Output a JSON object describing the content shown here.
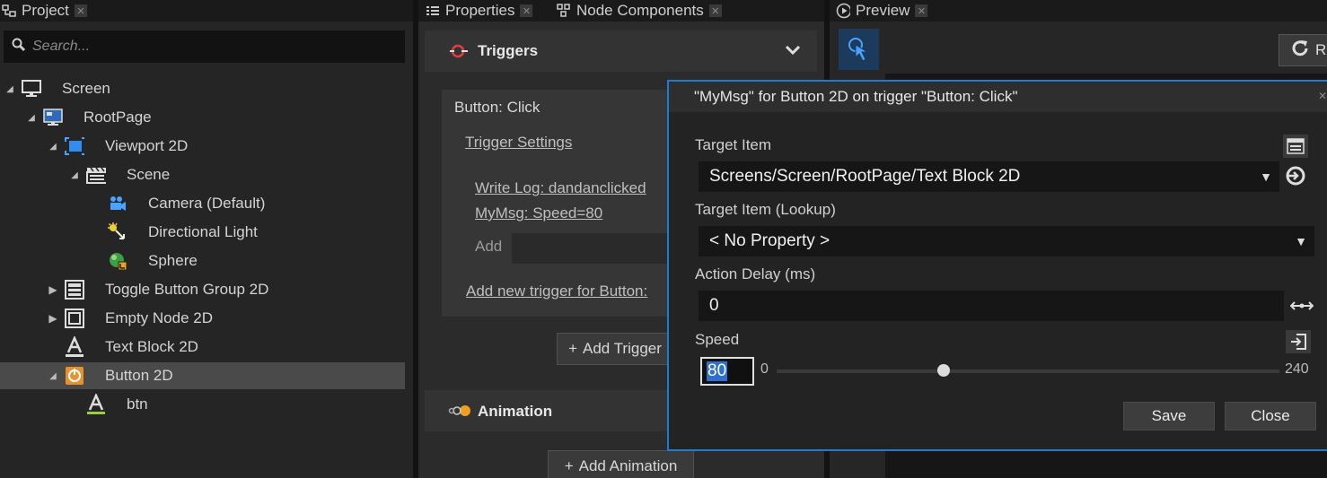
{
  "tabs": {
    "project": "Project",
    "properties": "Properties",
    "node_components": "Node Components",
    "preview": "Preview"
  },
  "project": {
    "search_placeholder": "Search...",
    "tree": [
      {
        "label": "Screen",
        "icon": "monitor-icon",
        "expanded": true
      },
      {
        "label": "RootPage",
        "icon": "page-icon",
        "expanded": true
      },
      {
        "label": "Viewport 2D",
        "icon": "viewport-icon",
        "expanded": true
      },
      {
        "label": "Scene",
        "icon": "clapper-icon",
        "expanded": true
      },
      {
        "label": "Camera (Default)",
        "icon": "camera-icon"
      },
      {
        "label": "Directional Light",
        "icon": "light-icon"
      },
      {
        "label": "Sphere",
        "icon": "sphere-icon"
      },
      {
        "label": "Toggle Button Group 2D",
        "icon": "toggle-group-icon",
        "expanded": false
      },
      {
        "label": "Empty Node 2D",
        "icon": "empty-node-icon",
        "expanded": false
      },
      {
        "label": "Text Block 2D",
        "icon": "text-icon"
      },
      {
        "label": "Button 2D",
        "icon": "button-icon",
        "expanded": true,
        "selected": true
      },
      {
        "label": "btn",
        "icon": "text-icon"
      }
    ]
  },
  "properties": {
    "triggers_title": "Triggers",
    "trigger_name": "Button: Click",
    "trigger_settings": "Trigger Settings",
    "actions": [
      "Write Log: dandanclicked",
      "MyMsg: Speed=80"
    ],
    "add_label": "Add",
    "add_new_trigger": "Add new trigger for Button:",
    "add_trigger_button": "Add Trigger",
    "animation_title": "Animation",
    "add_animation_button": "Add Animation"
  },
  "preview": {
    "refresh_label": "R"
  },
  "dialog": {
    "title": "\"MyMsg\" for Button 2D on trigger \"Button: Click\"",
    "target_item_label": "Target Item",
    "target_item_value": "Screens/Screen/RootPage/Text Block 2D",
    "lookup_label": "Target Item (Lookup)",
    "lookup_value": "< No Property >",
    "delay_label": "Action Delay (ms)",
    "delay_value": "0",
    "speed_label": "Speed",
    "speed_value": "80",
    "slider_min": "0",
    "slider_max": "240",
    "slider_fraction": 0.333,
    "save": "Save",
    "close": "Close"
  },
  "colors": {
    "accent": "#1e7ad6",
    "button_icon": "#e8922e"
  }
}
